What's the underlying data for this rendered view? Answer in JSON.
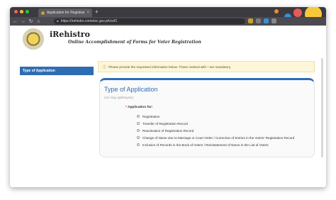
{
  "browser": {
    "tab_title": "Application for Registratio...",
    "url": "https://irehistro.comelec.gov.ph/cef1",
    "colors": {
      "close": "#ff5f57",
      "minimize": "#febc2e",
      "maximize": "#28c840"
    }
  },
  "header": {
    "brand": "iRehistro",
    "tagline": "Online Accomplishment of Forms for Voter Registration"
  },
  "sidebar": {
    "items": [
      {
        "label": "Type of Application"
      }
    ]
  },
  "notice": {
    "icon": "info-icon",
    "text": "Please provide the requested information below. Those marked with * are mandatory."
  },
  "form": {
    "title": "Type of Application",
    "subtitle": "(Uri ning aplikasyon)",
    "field_label": "Application for:",
    "required_mark": "*",
    "options": [
      "Registration",
      "Transfer of Registration Record",
      "Reactivation of Registration Record",
      "Change of Name due to Marriage or Court Order / Correction of Entries in the Voters' Registration Record",
      "Inclusion of Records in the Book of Voters / Reinstatement of Name in the List of Voters"
    ],
    "accent": "#2f6db3"
  }
}
